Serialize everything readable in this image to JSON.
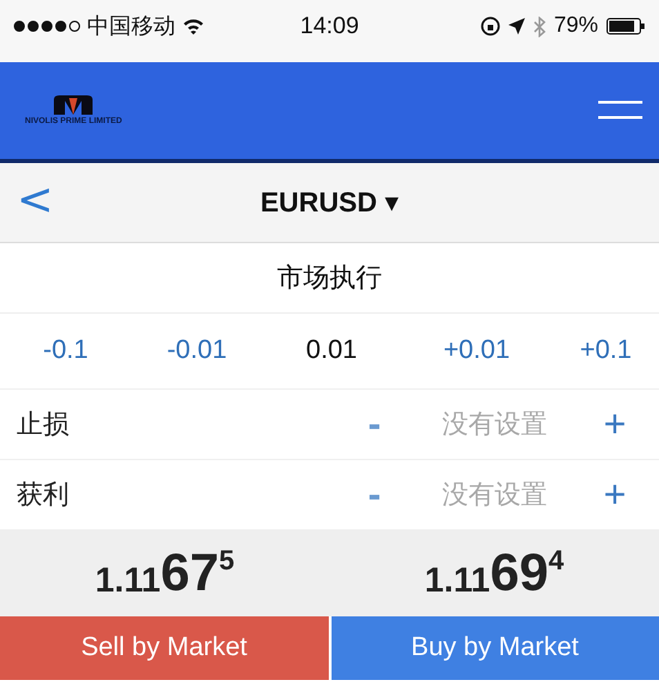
{
  "status_bar": {
    "carrier": "中国移动",
    "time": "14:09",
    "battery": "79%"
  },
  "header": {
    "logo_text": "NIVOLIS PRIME LIMITED"
  },
  "nav": {
    "back": "<",
    "symbol": "EURUSD ▾"
  },
  "execution": "市场执行",
  "volume": [
    {
      "kind": "step",
      "label": "-0.1"
    },
    {
      "kind": "step",
      "label": "-0.01"
    },
    {
      "kind": "value",
      "label": "0.01"
    },
    {
      "kind": "step",
      "label": "+0.01"
    },
    {
      "kind": "step",
      "label": "+0.1"
    }
  ],
  "levels": [
    {
      "label": "止损",
      "minus": "-",
      "placeholder": "没有设置",
      "plus": "+"
    },
    {
      "label": "获利",
      "minus": "-",
      "placeholder": "没有设置",
      "plus": "+"
    }
  ],
  "prices": [
    {
      "prefix": "1.11",
      "big": "67",
      "pip": "5"
    },
    {
      "prefix": "1.11",
      "big": "69",
      "pip": "4"
    }
  ],
  "buttons": [
    {
      "kind": "sell",
      "label": "Sell by Market"
    },
    {
      "kind": "buy",
      "label": "Buy by Market"
    }
  ]
}
